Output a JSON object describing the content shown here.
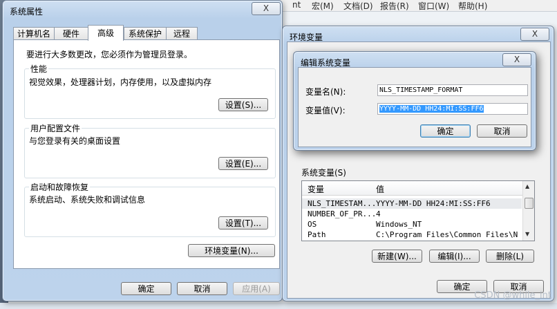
{
  "background_app": {
    "menu": [
      "nt",
      "宏(M)",
      "文档(D)",
      "报告(R)",
      "窗口(W)",
      "帮助(H)"
    ]
  },
  "system_properties": {
    "title": "系统属性",
    "tabs": [
      "计算机名",
      "硬件",
      "高级",
      "系统保护",
      "远程"
    ],
    "active_tab": "高级",
    "admin_note": "要进行大多数更改，您必须作为管理员登录。",
    "performance": {
      "label": "性能",
      "description": "视觉效果，处理器计划，内存使用，以及虚拟内存",
      "button": "设置(S)..."
    },
    "user_profiles": {
      "label": "用户配置文件",
      "description": "与您登录有关的桌面设置",
      "button": "设置(E)..."
    },
    "startup_recovery": {
      "label": "启动和故障恢复",
      "description": "系统启动、系统失败和调试信息",
      "button": "设置(T)..."
    },
    "env_button": "环境变量(N)...",
    "ok": "确定",
    "cancel": "取消",
    "apply": "应用(A)"
  },
  "env_vars": {
    "title": "环境变量",
    "system_vars_label": "系统变量(S)",
    "columns": [
      "变量",
      "值"
    ],
    "rows": [
      {
        "name": "NLS_TIMESTAM...",
        "value": "YYYY-MM-DD HH24:MI:SS:FF6"
      },
      {
        "name": "NUMBER_OF_PR...",
        "value": "4"
      },
      {
        "name": "OS",
        "value": "Windows_NT"
      },
      {
        "name": "Path",
        "value": "C:\\Program Files\\Common Files\\N"
      }
    ],
    "new": "新建(W)...",
    "edit": "编辑(I)...",
    "delete": "删除(L)",
    "ok": "确定",
    "cancel": "取消"
  },
  "edit_var": {
    "title": "编辑系统变量",
    "name_label": "变量名(N):",
    "name_value": "NLS_TIMESTAMP_FORMAT",
    "value_label": "变量值(V):",
    "value_value": "YYYY-MM-DD HH24:MI:SS:FF6",
    "ok": "确定",
    "cancel": "取消"
  },
  "watermark": "CSDN @while_int",
  "close_glyph": "X"
}
